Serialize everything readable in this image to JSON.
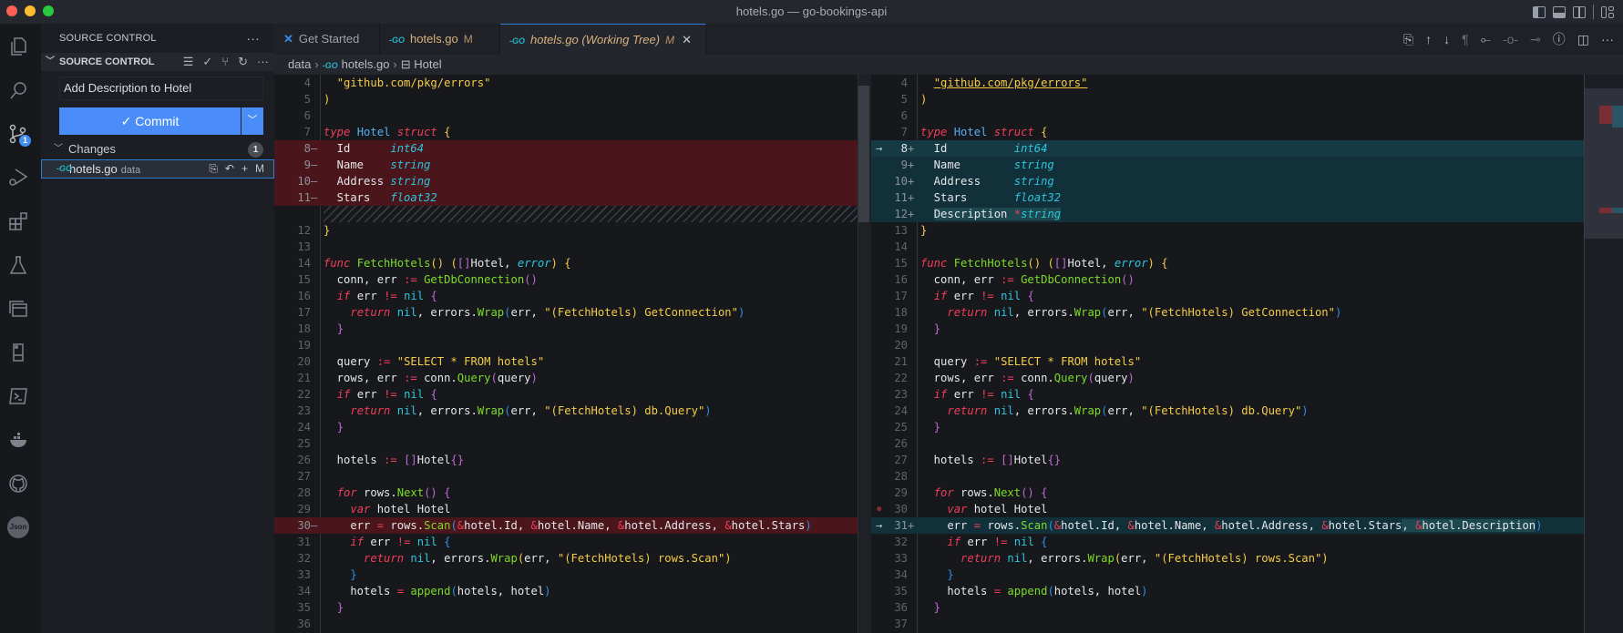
{
  "window": {
    "title": "hotels.go — go-bookings-api"
  },
  "activity_bar": {
    "items": [
      {
        "name": "explorer-icon"
      },
      {
        "name": "search-icon"
      },
      {
        "name": "source-control-icon",
        "badge": "1"
      },
      {
        "name": "run-debug-icon"
      },
      {
        "name": "extensions-icon"
      },
      {
        "name": "testing-icon"
      },
      {
        "name": "remote-explorer-icon"
      },
      {
        "name": "bookmarks-icon"
      },
      {
        "name": "terminal-icon"
      },
      {
        "name": "docker-icon"
      },
      {
        "name": "github-icon"
      },
      {
        "name": "json-icon",
        "label": "Json"
      }
    ]
  },
  "sidebar": {
    "header": "SOURCE CONTROL",
    "more": "···",
    "section_title": "SOURCE CONTROL",
    "commit_message": "Add Description to Hotel",
    "commit_label": "✓ Commit",
    "changes_label": "Changes",
    "changes_count": "1",
    "files": [
      {
        "name": "hotels.go",
        "dir": "data",
        "status": "M"
      }
    ]
  },
  "tabs": [
    {
      "label": "Get Started",
      "icon": "vscode-logo"
    },
    {
      "label": "hotels.go",
      "modified": "M"
    },
    {
      "label": "hotels.go (Working Tree)",
      "modified": "M",
      "active": true
    }
  ],
  "breadcrumb": [
    "data",
    "hotels.go",
    "Hotel"
  ],
  "colors": {
    "accent": "#4a8df8",
    "deleted_bg": "#4a151b",
    "added_bg": "#11303a"
  },
  "diff": {
    "left_numbers": [
      "4",
      "5",
      "6",
      "7",
      "8",
      "9",
      "10",
      "11",
      "",
      "12",
      "13",
      "14",
      "15",
      "16",
      "17",
      "18",
      "19",
      "20",
      "21",
      "22",
      "23",
      "24",
      "25",
      "26",
      "27",
      "28",
      "29",
      "30",
      "31",
      "32",
      "33",
      "34",
      "35",
      "36"
    ],
    "right_numbers": [
      "4",
      "5",
      "6",
      "7",
      "8",
      "9",
      "10",
      "11",
      "12",
      "13",
      "14",
      "15",
      "16",
      "17",
      "18",
      "19",
      "20",
      "21",
      "22",
      "23",
      "24",
      "25",
      "26",
      "27",
      "28",
      "29",
      "30",
      "31",
      "32",
      "33",
      "34",
      "35",
      "36",
      "37"
    ]
  }
}
